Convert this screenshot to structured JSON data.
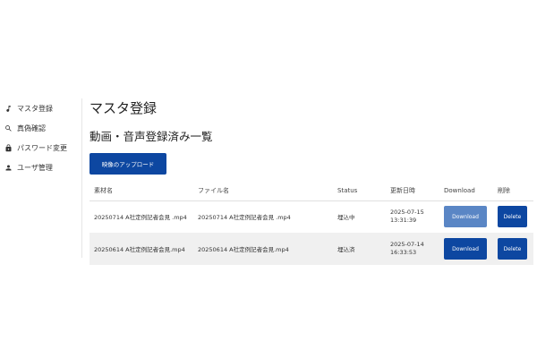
{
  "sidebar": {
    "items": [
      {
        "label": "マスタ登録",
        "icon": "music-note-icon"
      },
      {
        "label": "真偽確認",
        "icon": "search-icon"
      },
      {
        "label": "パスワード変更",
        "icon": "lock-icon"
      },
      {
        "label": "ユーザ管理",
        "icon": "person-icon"
      }
    ]
  },
  "main": {
    "page_title": "マスタ登録",
    "section_title": "動画・音声登録済み一覧",
    "upload_button_label": "映像のアップロード"
  },
  "table": {
    "headers": {
      "material_name": "素材名",
      "file_name": "ファイル名",
      "status": "Status",
      "updated_at": "更新日時",
      "download": "Download",
      "delete": "削除"
    },
    "rows": [
      {
        "material_name": "20250714 A社定例記者会見 .mp4",
        "file_name": "20250714 A社定例記者会見 .mp4",
        "status": "埋込中",
        "date": "2025-07-15",
        "time": "13:31:39",
        "download_label": "Download",
        "download_enabled": false,
        "delete_label": "Delete"
      },
      {
        "material_name": "20250614 A社定例記者会見.mp4",
        "file_name": "20250614 A社定例記者会見.mp4",
        "status": "埋込済",
        "date": "2025-07-14",
        "time": "16:33:53",
        "download_label": "Download",
        "download_enabled": true,
        "delete_label": "Delete"
      }
    ]
  },
  "colors": {
    "primary": "#0d47a1",
    "primary_disabled": "#5a86c5",
    "row_alt": "#f0f0f0"
  }
}
